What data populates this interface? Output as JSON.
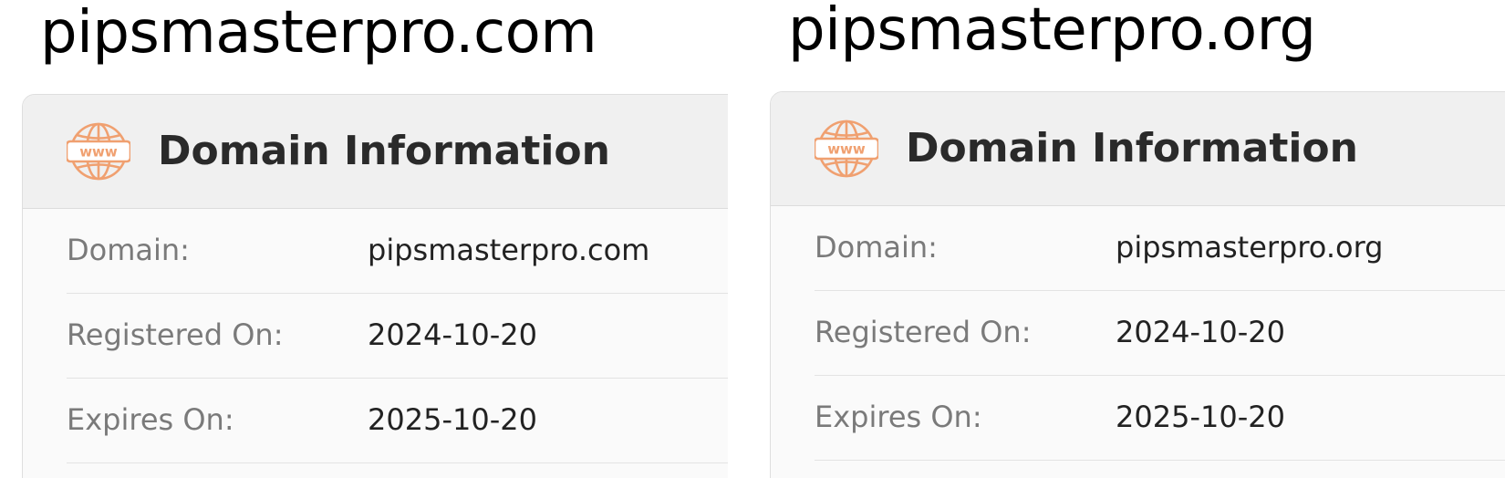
{
  "panels": [
    {
      "title": "pipsmasterpro.com",
      "card": {
        "heading": "Domain Information",
        "icon": "www-globe-icon",
        "icon_color": "#f0a070",
        "rows": [
          {
            "label": "Domain:",
            "value": "pipsmasterpro.com"
          },
          {
            "label": "Registered On:",
            "value": "2024-10-20"
          },
          {
            "label": "Expires On:",
            "value": "2025-10-20"
          }
        ]
      }
    },
    {
      "title": "pipsmasterpro.org",
      "card": {
        "heading": "Domain Information",
        "icon": "www-globe-icon",
        "icon_color": "#f0a070",
        "rows": [
          {
            "label": "Domain:",
            "value": "pipsmasterpro.org"
          },
          {
            "label": "Registered On:",
            "value": "2024-10-20"
          },
          {
            "label": "Expires On:",
            "value": "2025-10-20"
          }
        ]
      }
    }
  ]
}
